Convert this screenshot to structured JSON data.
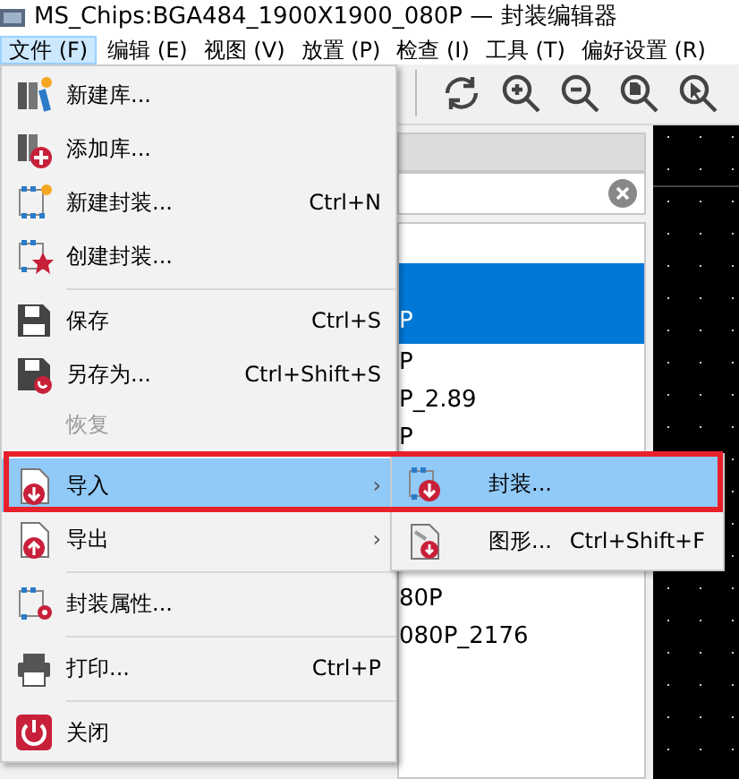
{
  "window": {
    "title": "MS_Chips:BGA484_1900X1900_080P — 封装编辑器"
  },
  "menubar": [
    {
      "label": "文件 (F)",
      "selected": true
    },
    {
      "label": "编辑 (E)",
      "selected": false
    },
    {
      "label": "视图 (V)",
      "selected": false
    },
    {
      "label": "放置 (P)",
      "selected": false
    },
    {
      "label": "检查 (I)",
      "selected": false
    },
    {
      "label": "工具 (T)",
      "selected": false
    },
    {
      "label": "偏好设置 (R)",
      "selected": false
    }
  ],
  "library_list": {
    "rows": [
      {
        "text": "P",
        "selected": true
      },
      {
        "text": "P",
        "selected": false
      },
      {
        "text": "P_2.89",
        "selected": false
      },
      {
        "text": "P",
        "selected": false
      },
      {
        "text": "80P",
        "selected": false
      },
      {
        "text": "080P_2176",
        "selected": false
      }
    ]
  },
  "file_menu": [
    {
      "kind": "item",
      "label": "新建库...",
      "disabled": false,
      "selected": false
    },
    {
      "kind": "item",
      "label": "添加库...",
      "disabled": false,
      "selected": false
    },
    {
      "kind": "item",
      "label": "新建封装...",
      "shortcut": "Ctrl+N",
      "disabled": false,
      "selected": false
    },
    {
      "kind": "item",
      "label": "创建封装...",
      "disabled": false,
      "selected": false
    },
    {
      "kind": "separator"
    },
    {
      "kind": "item",
      "label": "保存",
      "shortcut": "Ctrl+S",
      "disabled": false,
      "selected": false
    },
    {
      "kind": "item",
      "label": "另存为...",
      "shortcut": "Ctrl+Shift+S",
      "disabled": false,
      "selected": false
    },
    {
      "kind": "item",
      "label": "恢复",
      "disabled": true,
      "selected": false
    },
    {
      "kind": "separator"
    },
    {
      "kind": "submenu",
      "label": "导入",
      "arrow": "›",
      "disabled": false,
      "selected": true
    },
    {
      "kind": "submenu",
      "label": "导出",
      "arrow": "›",
      "disabled": false,
      "selected": false
    },
    {
      "kind": "separator"
    },
    {
      "kind": "item",
      "label": "封装属性...",
      "disabled": false,
      "selected": false
    },
    {
      "kind": "separator"
    },
    {
      "kind": "item",
      "label": "打印...",
      "shortcut": "Ctrl+P",
      "disabled": false,
      "selected": false
    },
    {
      "kind": "separator"
    },
    {
      "kind": "item",
      "label": "关闭",
      "disabled": false,
      "selected": false
    }
  ],
  "import_submenu": [
    {
      "label": "封装...",
      "selected": true
    },
    {
      "label": "图形...",
      "shortcut": "Ctrl+Shift+F",
      "selected": false
    }
  ]
}
